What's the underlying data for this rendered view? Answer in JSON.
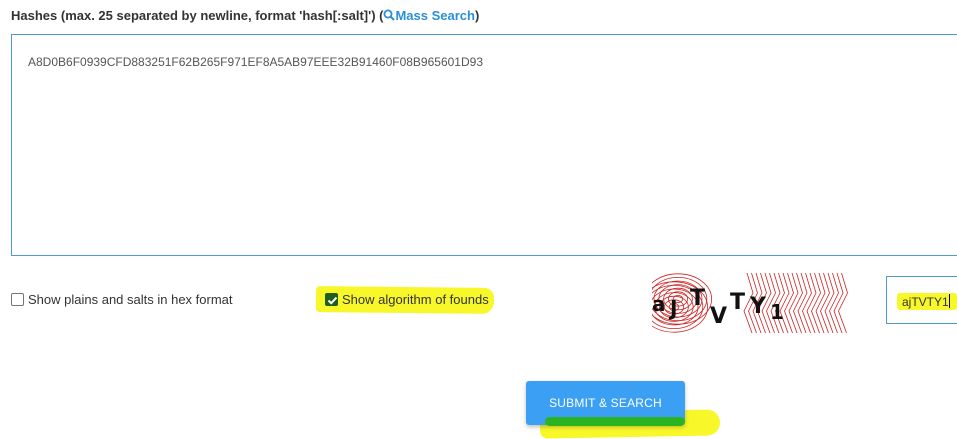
{
  "form": {
    "hash_label": "Hashes (max. 25 separated by newline, format 'hash[:salt]') (",
    "hash_label_end": ")",
    "mass_search_label": "Mass Search",
    "hashes_value": "A8D0B6F0939CFD883251F62B265F971EF8A5AB97EEE32B91460F08B965601D93"
  },
  "options": {
    "hex_label": "Show plains and salts in hex format",
    "hex_checked": false,
    "algo_label": "Show algorithm of founds",
    "algo_checked": true
  },
  "captcha": {
    "image_text": "aJTVTY1",
    "input_value": "ajTVTY1"
  },
  "submit": {
    "label": "SUBMIT & SEARCH"
  },
  "colors": {
    "accent": "#3ba0f3",
    "link": "#2a8fd8",
    "highlight": "#f7f72a",
    "captcha_lines": "#cc2222"
  }
}
